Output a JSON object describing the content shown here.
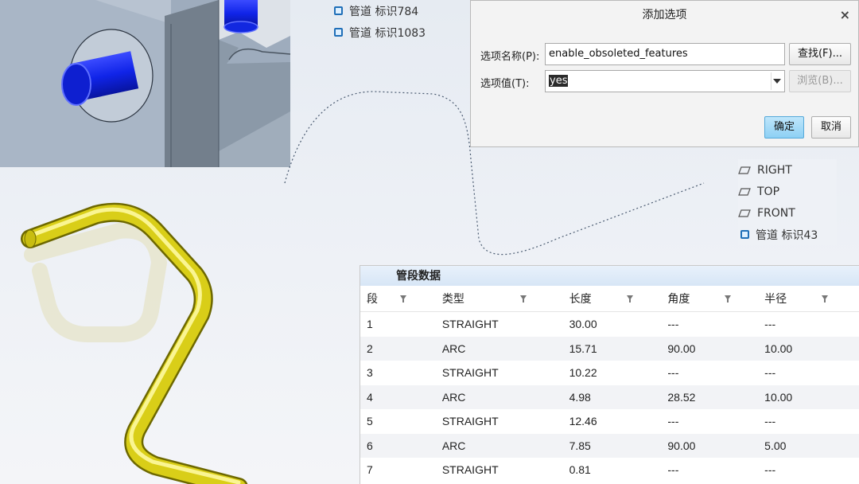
{
  "tree_top": [
    {
      "label": "管道 标识784",
      "icon": "pipe-icon"
    },
    {
      "label": "管道 标识1083",
      "icon": "pipe-icon"
    }
  ],
  "dialog": {
    "title": "添加选项",
    "close": "×",
    "name_label": "选项名称(P):",
    "name_value": "enable_obsoleted_features",
    "find_button": "查找(F)...",
    "value_label": "选项值(T):",
    "value_selected": "yes",
    "browse_button": "浏览(B)...",
    "ok_button": "确定",
    "cancel_button": "取消"
  },
  "tree_right": [
    {
      "label": "RIGHT",
      "icon": "datum-plane-icon"
    },
    {
      "label": "TOP",
      "icon": "datum-plane-icon"
    },
    {
      "label": "FRONT",
      "icon": "datum-plane-icon"
    },
    {
      "label": "管道 标识43",
      "icon": "pipe-icon"
    }
  ],
  "segment_table": {
    "title": "管段数据",
    "columns": [
      "段",
      "类型",
      "长度",
      "角度",
      "半径"
    ],
    "rows": [
      [
        "1",
        "STRAIGHT",
        "30.00",
        "---",
        "---"
      ],
      [
        "2",
        "ARC",
        "15.71",
        "90.00",
        "10.00"
      ],
      [
        "3",
        "STRAIGHT",
        "10.22",
        "---",
        "---"
      ],
      [
        "4",
        "ARC",
        "4.98",
        "28.52",
        "10.00"
      ],
      [
        "5",
        "STRAIGHT",
        "12.46",
        "---",
        "---"
      ],
      [
        "6",
        "ARC",
        "7.85",
        "90.00",
        "5.00"
      ],
      [
        "7",
        "STRAIGHT",
        "0.81",
        "---",
        "---"
      ]
    ]
  },
  "colors": {
    "pipe_blue": "#1428e6",
    "pipe_yellow": "#e6db1a",
    "block_gray": "#8c9aab",
    "accent_button": "#8dd0f4"
  }
}
